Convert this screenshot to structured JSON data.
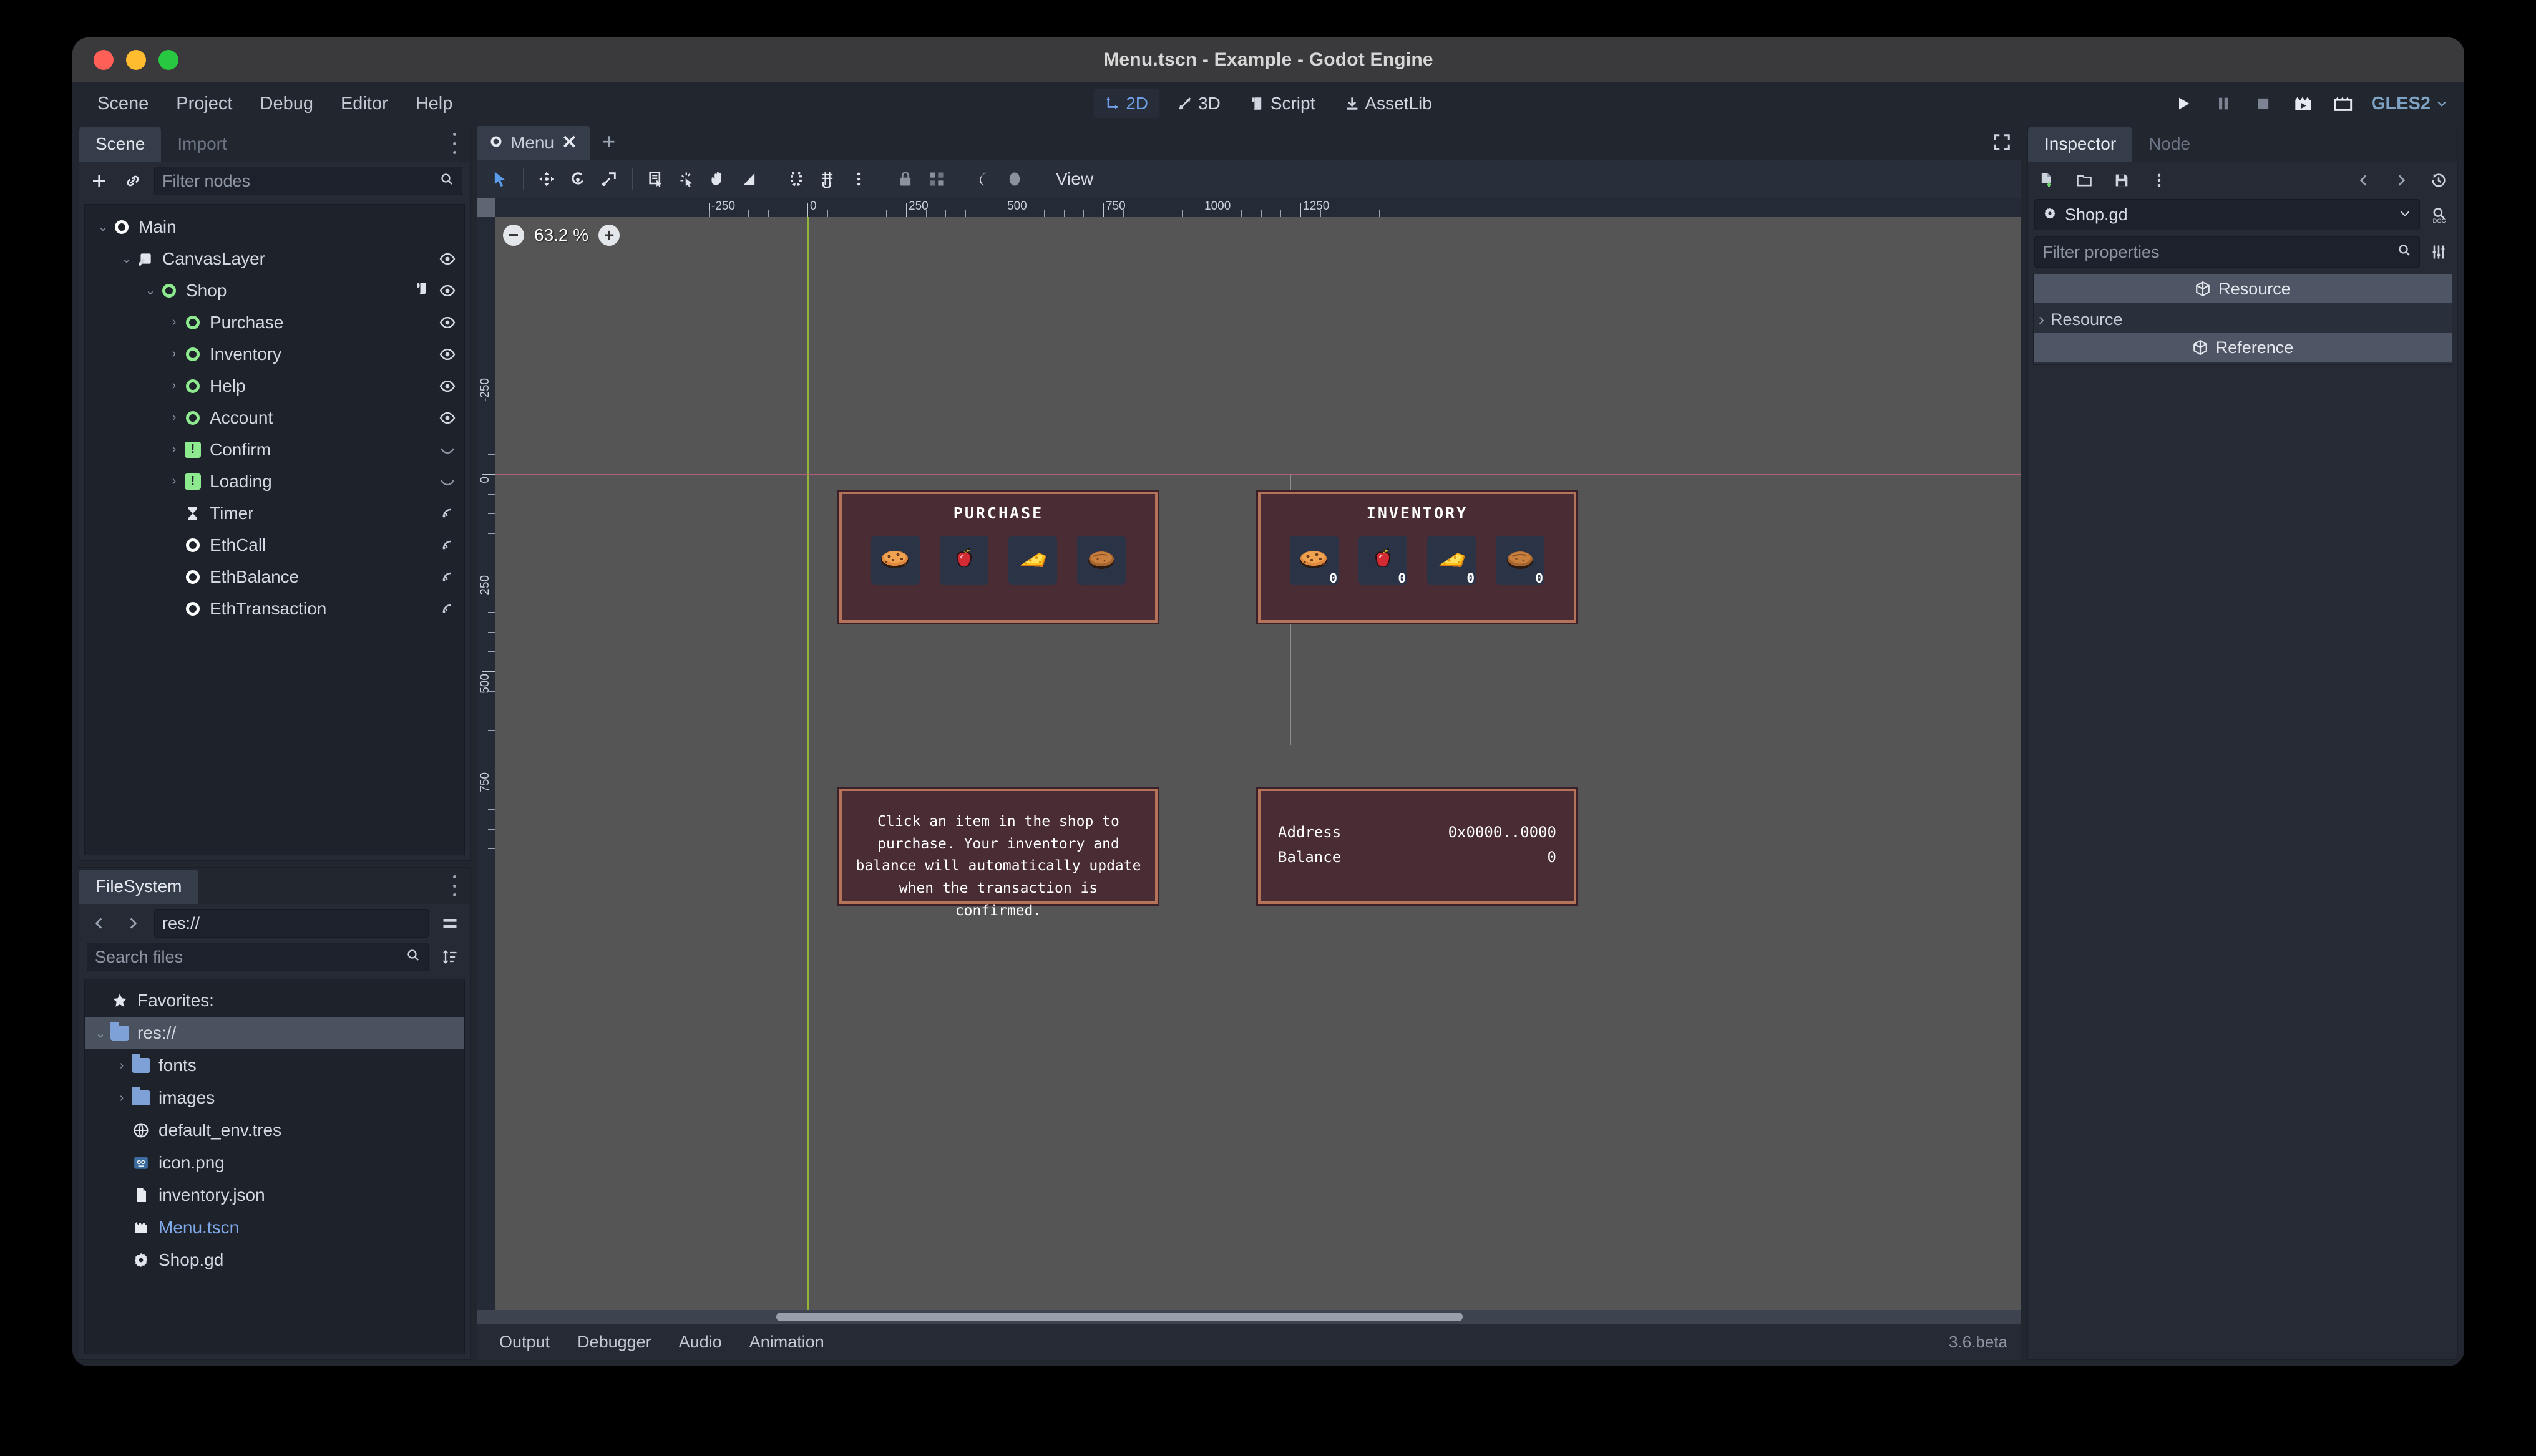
{
  "window": {
    "title": "Menu.tscn - Example - Godot Engine"
  },
  "menubar": {
    "items": [
      "Scene",
      "Project",
      "Debug",
      "Editor",
      "Help"
    ],
    "center_tools": [
      {
        "label": "2D",
        "icon": "2d-icon",
        "active": true
      },
      {
        "label": "3D",
        "icon": "3d-icon",
        "active": false
      },
      {
        "label": "Script",
        "icon": "script-icon",
        "active": false
      },
      {
        "label": "AssetLib",
        "icon": "assetlib-icon",
        "active": false
      }
    ],
    "right_tools": [
      "play-icon",
      "pause-icon",
      "stop-icon",
      "play-scene-icon",
      "play-custom-scene-icon"
    ],
    "renderer": "GLES2"
  },
  "scene_dock": {
    "tabs": [
      {
        "label": "Scene",
        "selected": true
      },
      {
        "label": "Import",
        "selected": false
      }
    ],
    "toolbar": {
      "add_icon": "plus-icon",
      "link_icon": "link-icon",
      "filter_placeholder": "Filter nodes",
      "search_icon": "search-icon"
    },
    "tree": [
      {
        "label": "Main",
        "depth": 0,
        "arrow": "down",
        "icon": "node-circle",
        "icon_color": "white",
        "right": []
      },
      {
        "label": "CanvasLayer",
        "depth": 1,
        "arrow": "down",
        "icon": "canvaslayer-icon",
        "icon_color": "white",
        "right": [
          "visibility-eye-icon"
        ]
      },
      {
        "label": "Shop",
        "depth": 2,
        "arrow": "down",
        "icon": "node-circle",
        "icon_color": "green",
        "right": [
          "script-icon",
          "visibility-eye-icon"
        ]
      },
      {
        "label": "Purchase",
        "depth": 3,
        "arrow": "right",
        "icon": "node-circle",
        "icon_color": "green",
        "right": [
          "visibility-eye-icon"
        ]
      },
      {
        "label": "Inventory",
        "depth": 3,
        "arrow": "right",
        "icon": "node-circle",
        "icon_color": "green",
        "right": [
          "visibility-eye-icon"
        ]
      },
      {
        "label": "Help",
        "depth": 3,
        "arrow": "right",
        "icon": "node-circle",
        "icon_color": "green",
        "right": [
          "visibility-eye-icon"
        ]
      },
      {
        "label": "Account",
        "depth": 3,
        "arrow": "right",
        "icon": "node-circle",
        "icon_color": "green",
        "right": [
          "visibility-eye-icon"
        ]
      },
      {
        "label": "Confirm",
        "depth": 3,
        "arrow": "right",
        "icon": "warning-square",
        "icon_color": "green",
        "right": [
          "visibility-hidden-icon"
        ]
      },
      {
        "label": "Loading",
        "depth": 3,
        "arrow": "right",
        "icon": "warning-square",
        "icon_color": "green",
        "right": [
          "visibility-hidden-icon"
        ]
      },
      {
        "label": "Timer",
        "depth": 3,
        "arrow": "none",
        "icon": "timer-icon",
        "icon_color": "white",
        "right": [
          "signal-icon"
        ]
      },
      {
        "label": "EthCall",
        "depth": 3,
        "arrow": "none",
        "icon": "node-circle",
        "icon_color": "white",
        "right": [
          "signal-icon"
        ]
      },
      {
        "label": "EthBalance",
        "depth": 3,
        "arrow": "none",
        "icon": "node-circle",
        "icon_color": "white",
        "right": [
          "signal-icon"
        ]
      },
      {
        "label": "EthTransaction",
        "depth": 3,
        "arrow": "none",
        "icon": "node-circle",
        "icon_color": "white",
        "right": [
          "signal-icon"
        ]
      }
    ]
  },
  "filesystem_dock": {
    "title": "FileSystem",
    "nav": {
      "back_icon": "chevron-left-icon",
      "forward_icon": "chevron-right-icon",
      "path": "res://",
      "split_icon": "split-mode-icon"
    },
    "search": {
      "placeholder": "Search files",
      "search_icon": "search-icon",
      "sort_icon": "sort-icon"
    },
    "items": [
      {
        "label": "Favorites:",
        "depth": 0,
        "arrow": "none",
        "icon": "star-icon",
        "selected": false,
        "link": false
      },
      {
        "label": "res://",
        "depth": 0,
        "arrow": "down",
        "icon": "folder-icon",
        "selected": true,
        "link": false
      },
      {
        "label": "fonts",
        "depth": 1,
        "arrow": "right",
        "icon": "folder-icon",
        "selected": false,
        "link": false
      },
      {
        "label": "images",
        "depth": 1,
        "arrow": "right",
        "icon": "folder-icon",
        "selected": false,
        "link": false
      },
      {
        "label": "default_env.tres",
        "depth": 1,
        "arrow": "none",
        "icon": "environment-icon",
        "selected": false,
        "link": false
      },
      {
        "label": "icon.png",
        "depth": 1,
        "arrow": "none",
        "icon": "godot-image-icon",
        "selected": false,
        "link": false
      },
      {
        "label": "inventory.json",
        "depth": 1,
        "arrow": "none",
        "icon": "file-icon",
        "selected": false,
        "link": false
      },
      {
        "label": "Menu.tscn",
        "depth": 1,
        "arrow": "none",
        "icon": "scene-icon",
        "selected": false,
        "link": true
      },
      {
        "label": "Shop.gd",
        "depth": 1,
        "arrow": "none",
        "icon": "gdscript-icon",
        "selected": false,
        "link": false
      }
    ]
  },
  "viewport": {
    "scene_tab": {
      "label": "Menu",
      "icon": "node-circle",
      "close_icon": "close-icon"
    },
    "add_tab_icon": "plus-icon",
    "fullscreen_icon": "distraction-free-icon",
    "toolbar_icons": [
      "select-mode-icon",
      "move-mode-icon",
      "rotate-mode-icon",
      "scale-mode-icon",
      "list-select-icon",
      "ruler-click-icon",
      "pan-mode-icon",
      "ruler-mode-icon",
      "snap-magnet-icon",
      "grid-snap-icon",
      "snap-options-icon",
      "lock-icon",
      "group-icon",
      "skeleton-icon",
      "bone-icon"
    ],
    "view_menu_label": "View",
    "zoom": {
      "minus_icon": "zoom-out-icon",
      "value": "63.2 %",
      "plus_icon": "zoom-in-icon"
    },
    "ruler_h_labels": [
      "-250",
      "0",
      "250",
      "500",
      "750",
      "1000",
      "1250"
    ],
    "ruler_v_labels": [
      "-250",
      "0",
      "250",
      "500",
      "750"
    ]
  },
  "game": {
    "purchase_panel": {
      "title": "PURCHASE",
      "slots": [
        {
          "item": "cookie",
          "count": null
        },
        {
          "item": "apple",
          "count": null
        },
        {
          "item": "cheese",
          "count": null
        },
        {
          "item": "bread",
          "count": null
        }
      ]
    },
    "inventory_panel": {
      "title": "INVENTORY",
      "slots": [
        {
          "item": "cookie",
          "count": "0"
        },
        {
          "item": "apple",
          "count": "0"
        },
        {
          "item": "cheese",
          "count": "0"
        },
        {
          "item": "bread",
          "count": "0"
        }
      ]
    },
    "help_panel": {
      "text": "Click an item in the shop to purchase. Your inventory and balance will automatically update when the transaction is confirmed."
    },
    "account_panel": {
      "rows": [
        {
          "label": "Address",
          "value": "0x0000..0000"
        },
        {
          "label": "Balance",
          "value": "0"
        }
      ]
    }
  },
  "bottom_bar": {
    "items": [
      "Output",
      "Debugger",
      "Audio",
      "Animation"
    ],
    "version": "3.6.beta"
  },
  "inspector": {
    "tabs": [
      {
        "label": "Inspector",
        "selected": true
      },
      {
        "label": "Node",
        "selected": false
      }
    ],
    "toolbar": {
      "new_icon": "new-resource-icon",
      "open_icon": "open-resource-icon",
      "save_icon": "save-resource-icon",
      "more_icon": "more-options-icon",
      "back_icon": "history-back-icon",
      "forward_icon": "history-forward-icon",
      "history_icon": "history-icon"
    },
    "resource": {
      "icon": "gdscript-icon",
      "name": "Shop.gd",
      "dropdown_icon": "chevron-down-icon",
      "doc_icon": "search-doc-icon"
    },
    "filter": {
      "placeholder": "Filter properties",
      "search_icon": "search-icon",
      "tools_icon": "object-tools-icon"
    },
    "sections": [
      {
        "type": "category",
        "label": "Resource",
        "icon": "resource-cube-icon"
      },
      {
        "type": "group",
        "label": "Resource",
        "arrow": "right"
      },
      {
        "type": "category",
        "label": "Reference",
        "icon": "resource-cube-icon"
      }
    ]
  },
  "colors": {
    "accent": "#5a9ded",
    "panel_bg": "#252a35",
    "editor_bg": "#21262f",
    "viewport_bg": "#555555",
    "game_panel_bg": "#4a2c35",
    "game_panel_border": "#b5735a",
    "node_green": "#8eea8e"
  }
}
